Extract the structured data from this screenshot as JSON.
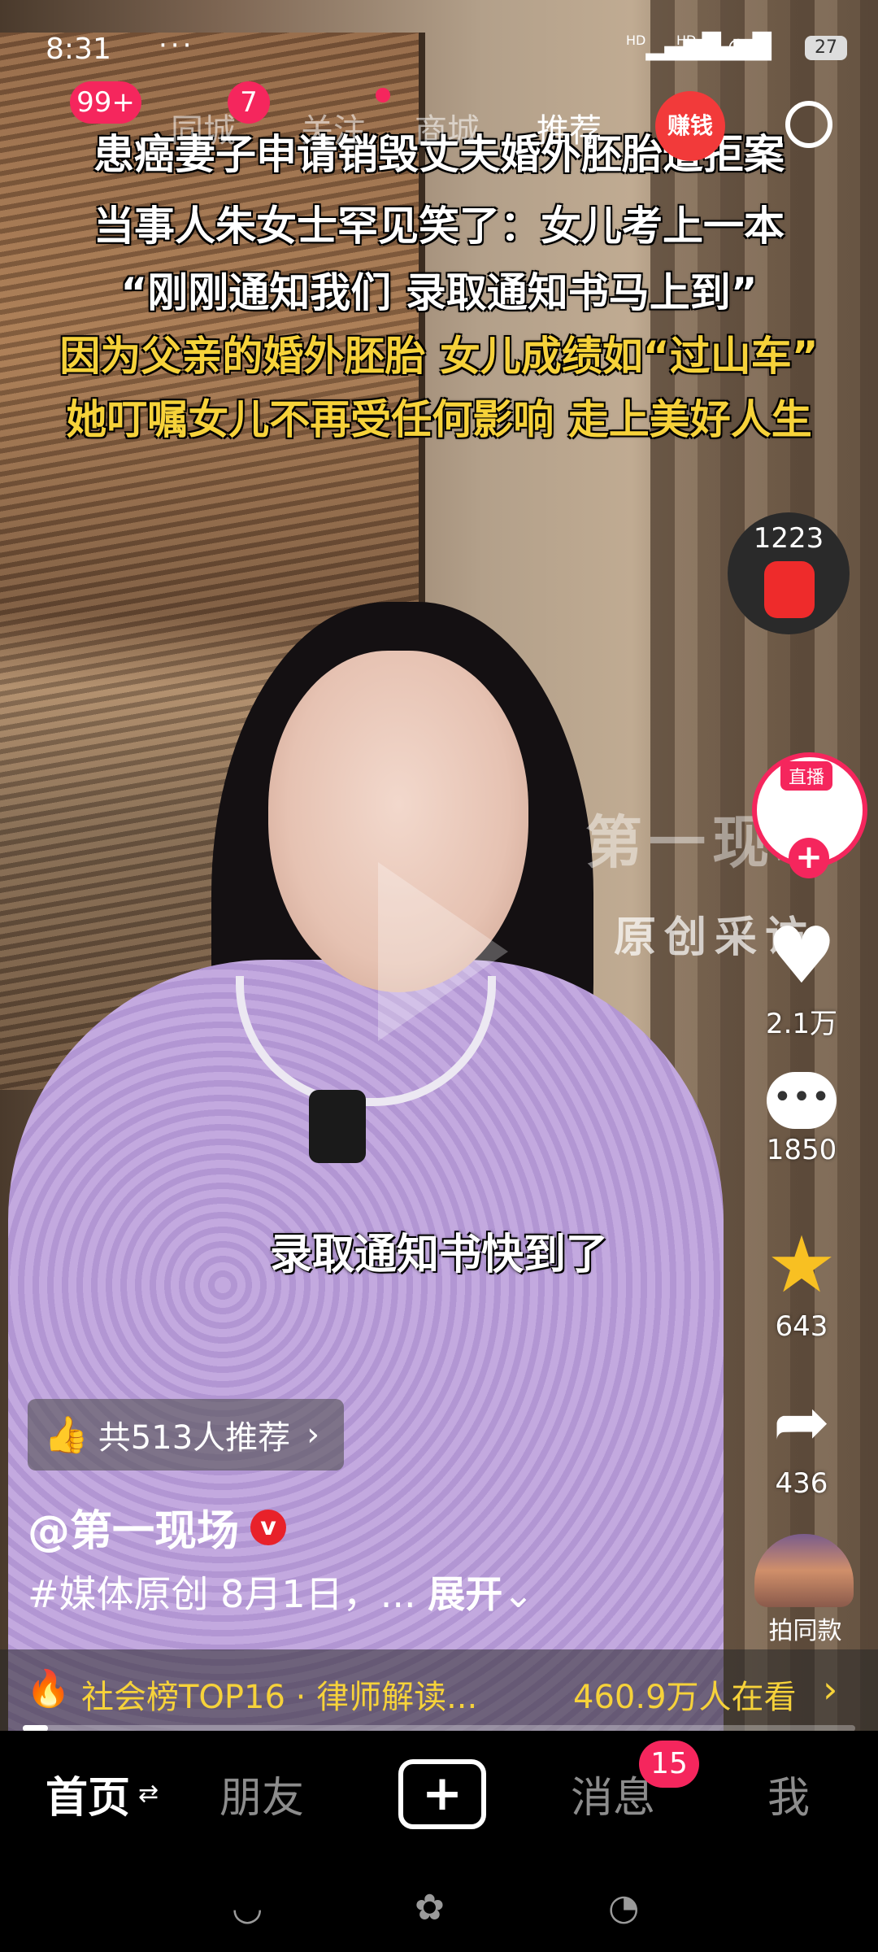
{
  "status_bar": {
    "time": "8:31",
    "more": "···",
    "net1": "HD",
    "net2": "HD",
    "battery": "27"
  },
  "top_nav": {
    "tabs": [
      "同城",
      "关注",
      "商城",
      "推荐"
    ],
    "badge_menu": "99+",
    "badge_tab": "7",
    "earn_label": "赚钱"
  },
  "headlines": {
    "line1": "患癌妻子申请销毁丈夫婚外胚胎遭拒案",
    "line2": "当事人朱女士罕见笑了：女儿考上一本",
    "line3": "“刚刚通知我们 录取通知书马上到”",
    "line4": "因为父亲的婚外胚胎 女儿成绩如“过山车”",
    "line5": "她叮嘱女儿不再受任何影响 走上美好人生"
  },
  "watermark": {
    "brand": "第一现场",
    "tag": "原创采访"
  },
  "caption": "录取通知书快到了",
  "right_rail": {
    "coins": "1223",
    "live_tag": "直播",
    "likes": "2.1万",
    "comments": "1850",
    "favorites": "643",
    "shares": "436",
    "same_style": "拍同款"
  },
  "post": {
    "recommend": "共513人推荐",
    "author": "@第一现场",
    "verified": "v",
    "description": "#媒体原创 8月1日，... ",
    "expand": "展开"
  },
  "hot_bar": {
    "text": "社会榜TOP16 · 律师解读...",
    "viewers": "460.9万人在看"
  },
  "progress": {
    "fraction": 0.03
  },
  "bottom_tabs": {
    "home": "首页",
    "friends": "朋友",
    "create": "+",
    "messages": "消息",
    "messages_badge": "15",
    "me": "我"
  },
  "colors": {
    "accent": "#f5265d",
    "highlight": "#f6d23a"
  }
}
